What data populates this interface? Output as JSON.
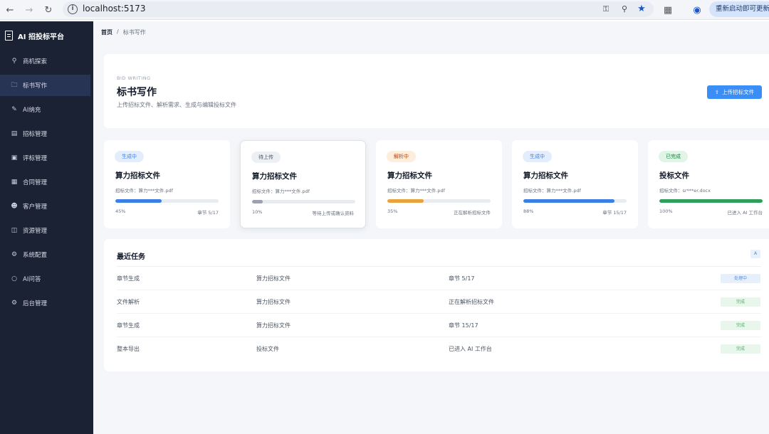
{
  "browser": {
    "url": "localhost:5173",
    "update_label": "重新启动即可更新"
  },
  "sidebar": {
    "brand": "AI 招投标平台",
    "items": [
      {
        "label": "商机探索",
        "icon": "search-icon"
      },
      {
        "label": "标书写作",
        "icon": "folder-icon",
        "active": true
      },
      {
        "label": "AI纳充",
        "icon": "pen-icon"
      },
      {
        "label": "招标管理",
        "icon": "file-icon"
      },
      {
        "label": "评标管理",
        "icon": "badge-icon"
      },
      {
        "label": "合同管理",
        "icon": "contract-icon"
      },
      {
        "label": "客户管理",
        "icon": "user-icon"
      },
      {
        "label": "资源管理",
        "icon": "database-icon"
      },
      {
        "label": "系统配置",
        "icon": "gear-icon"
      },
      {
        "label": "AI问答",
        "icon": "chat-icon"
      },
      {
        "label": "后台管理",
        "icon": "settings-icon"
      }
    ]
  },
  "breadcrumb": {
    "home": "首页",
    "separator": "/",
    "current": "标书写作"
  },
  "header": {
    "eyebrow": "BID WRITING",
    "title": "标书写作",
    "description": "上传招标文件、解析需求、生成与编辑投标文件",
    "upload_label": "上传招标文件"
  },
  "tasks": [
    {
      "badge": "生成中",
      "badge_color": "#3b82f6",
      "badge_bg": "#e3edfc",
      "title": "算力招标文件",
      "file": "招标文件：算力***文件.pdf",
      "percent_label": "45%",
      "progress": 0.45,
      "bar_color": "#3a7ee8",
      "status": "章节 5/17"
    },
    {
      "badge": "待上传",
      "badge_color": "#4b5563",
      "badge_bg": "#eceff3",
      "title": "算力招标文件",
      "file": "招标文件：算力***文件.pdf",
      "percent_label": "10%",
      "progress": 0.1,
      "bar_color": "#9aa0b5",
      "status": "等待上传或确认资料"
    },
    {
      "badge": "解析中",
      "badge_color": "#c2410c",
      "badge_bg": "#fdeedb",
      "title": "算力招标文件",
      "file": "招标文件：算力***文件.pdf",
      "percent_label": "35%",
      "progress": 0.35,
      "bar_color": "#e8a33a",
      "status": "正在解析招标文件"
    },
    {
      "badge": "生成中",
      "badge_color": "#3b82f6",
      "badge_bg": "#e3edfc",
      "title": "算力招标文件",
      "file": "招标文件：算力***文件.pdf",
      "percent_label": "88%",
      "progress": 0.88,
      "bar_color": "#3a7ee8",
      "status": "章节 15/17"
    },
    {
      "badge": "已完成",
      "badge_color": "#15803d",
      "badge_bg": "#e0f5e6",
      "title": "投标文件",
      "file": "招标文件：sr***er.docx",
      "percent_label": "100%",
      "progress": 1.0,
      "bar_color": "#2f9e5a",
      "status": "已进入 AI 工作台"
    }
  ],
  "recent": {
    "title": "最近任务",
    "corner_label": "A",
    "rows": [
      {
        "type": "章节生成",
        "name": "算力招标文件",
        "detail": "章节 5/17",
        "status": "处理中",
        "status_color": "#5b8fd8",
        "status_bg": "#e6effc"
      },
      {
        "type": "文件解析",
        "name": "算力招标文件",
        "detail": "正在解析招标文件",
        "status": "完成",
        "status_color": "#4caf6a",
        "status_bg": "#e8f6ec"
      },
      {
        "type": "章节生成",
        "name": "算力招标文件",
        "detail": "章节 15/17",
        "status": "完成",
        "status_color": "#4caf6a",
        "status_bg": "#e8f6ec"
      },
      {
        "type": "整本导出",
        "name": "投标文件",
        "detail": "已进入 AI 工作台",
        "status": "完成",
        "status_color": "#4caf6a",
        "status_bg": "#e8f6ec"
      }
    ]
  }
}
